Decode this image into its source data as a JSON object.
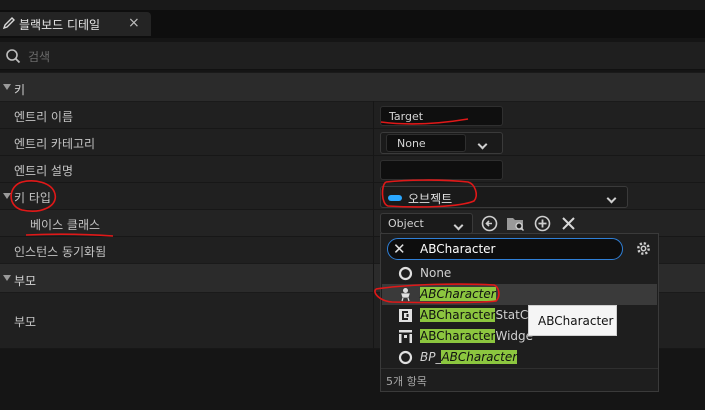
{
  "tab": {
    "title": "블랙보드 디테일",
    "close_glyph": "×"
  },
  "search": {
    "placeholder": "검색"
  },
  "key_section": {
    "title": "키",
    "rows": [
      {
        "label": "엔트리 이름",
        "value": "Target"
      },
      {
        "label": "엔트리 카테고리",
        "value": "None"
      },
      {
        "label": "엔트리 설명",
        "value": ""
      },
      {
        "label": "키 타입",
        "value": "오브젝트",
        "pill_color": "#2aa7ff"
      },
      {
        "label": "베이스 클래스",
        "value": "Object"
      },
      {
        "label": "인스턴스 동기화됨"
      }
    ]
  },
  "parent_section": {
    "title": "부모",
    "rows": [
      {
        "label": "부모"
      }
    ]
  },
  "popup": {
    "search_value": "ABCharacter",
    "items": [
      {
        "icon": "circle-icon",
        "prefix": "",
        "match": "",
        "text": "None",
        "suffix": ""
      },
      {
        "icon": "character-icon",
        "prefix": "",
        "match": "ABCharacter",
        "suffix": "",
        "italic": true,
        "selected": true
      },
      {
        "icon": "component-icon",
        "prefix": "",
        "match": "ABCharacter",
        "suffix": "StatCo"
      },
      {
        "icon": "widget-icon",
        "prefix": "",
        "match": "ABCharacter",
        "suffix": "Widge"
      },
      {
        "icon": "circle-icon",
        "prefix": "BP_",
        "match": "ABCharacter",
        "suffix": "",
        "italic": true
      }
    ],
    "count_label": "5개 항목"
  },
  "tooltip": {
    "text": "ABCharacter"
  },
  "colors": {
    "highlight": "#8cc63f",
    "focus": "#2f7fd6",
    "annotation": "#e01818"
  }
}
